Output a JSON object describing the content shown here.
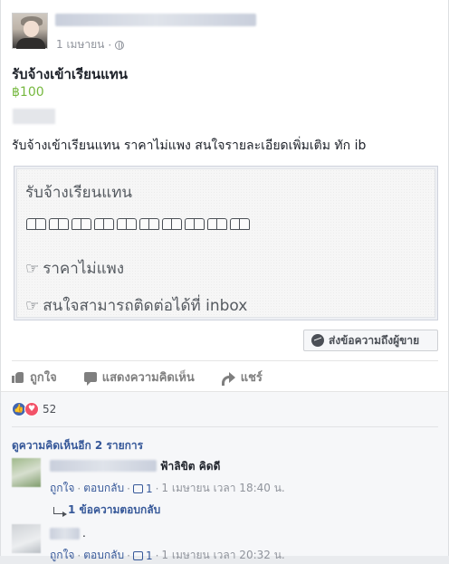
{
  "post": {
    "date": "1 เมษายน",
    "title": "รับจ้างเข้าเรียนแทน",
    "price": "฿100",
    "description": "รับจ้างเข้าเรียนแทน ราคาไม่แพง สนใจรายละเอียดเพิ่มเติม ทัก ib",
    "image_text": {
      "line1": "รับจ้างเรียนแทน",
      "books_icon": "open-book-icon",
      "line3": "ราคาไม่แพง",
      "line4": "สนใจสามารถติดต่อได้ที่  inbox",
      "pointer_icon": "pointing-hand-icon"
    },
    "message_seller_label": "ส่งข้อความถึงผู้ขาย"
  },
  "actions": {
    "like": "ถูกใจ",
    "comment": "แสดงความคิดเห็น",
    "share": "แชร์"
  },
  "reactions": {
    "count": "52",
    "types": [
      "like",
      "love"
    ]
  },
  "comments": {
    "more_label": "ดูความคิดเห็นอีก 2 รายการ",
    "items": [
      {
        "text": "ฟ้าลิขิต คิดดี",
        "like_label": "ถูกใจ",
        "reply_label": "ตอบกลับ",
        "like_count": "1",
        "time": "1 เมษายน เวลา 18:40 น.",
        "replies_label": "1 ข้อความตอบกลับ"
      },
      {
        "text": ".",
        "like_label": "ถูกใจ",
        "reply_label": "ตอบกลับ",
        "like_count": "1",
        "time": "1 เมษายน เวลา 20:32 น."
      }
    ]
  },
  "colors": {
    "price": "#76b83f",
    "link": "#365899",
    "like_reaction": "#4267b2",
    "love_reaction": "#f25268"
  }
}
